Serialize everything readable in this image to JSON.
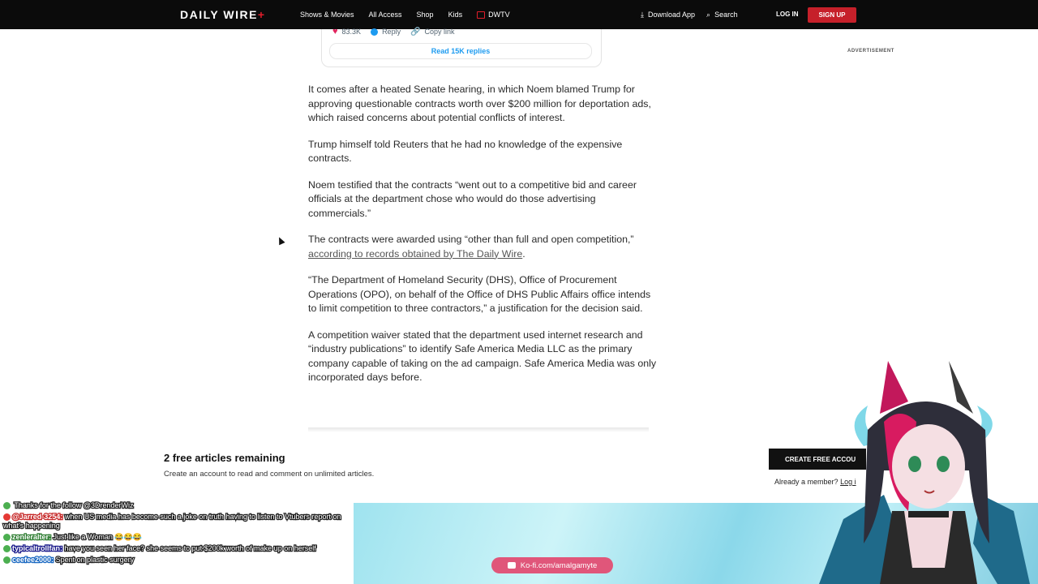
{
  "header": {
    "logo": "DAILY WIRE",
    "logo_plus": "+",
    "nav": [
      "Shows & Movies",
      "All Access",
      "Shop",
      "Kids",
      "DWTV"
    ],
    "download": "Download App",
    "search": "Search",
    "login": "LOG IN",
    "signup": "SIGN UP"
  },
  "tweet": {
    "likes": "83.3K",
    "reply": "Reply",
    "copy": "Copy link",
    "read_replies": "Read 15K replies"
  },
  "advertisement": "ADVERTISEMENT",
  "article": {
    "p1": "It comes after a heated Senate hearing, in which Noem blamed Trump for approving questionable contracts worth over $200 million for deportation ads, which raised concerns about potential conflicts of interest.",
    "p2": "Trump himself told Reuters that he had no knowledge of the expensive contracts.",
    "p3": "Noem testified that the contracts “went out to a competitive bid and career officials at the department chose who would do those advertising commercials.”",
    "p4a": "The contracts were awarded using “other than full and open competition,”",
    "p4link": "according to records obtained by The Daily Wire",
    "p4b": ".",
    "p5": "“The Department of Homeland Security (DHS), Office of Procurement Operations (OPO), on behalf of the Office of DHS Public Affairs office intends to limit competition to three contractors,” a justification for the decision said.",
    "p6": "A competition waiver stated that the department used internet research and “industry publications” to identify Safe America Media LLC as the primary company capable of taking on the ad campaign. Safe America Media was only incorporated days before."
  },
  "paywall": {
    "title": "2 free articles remaining",
    "subtitle": "Create an account to read and comment on unlimited articles.",
    "create": "CREATE FREE ACCOU",
    "member": "Already a member?",
    "login": "Log i"
  },
  "chat": [
    {
      "user": "",
      "msg": "Thanks for the follow @3DrenderWiz",
      "color": "#e11d2a"
    },
    {
      "user": "@Jarred-3254:",
      "msg": "when US media has become such a joke on truth having to listen to Vtubers report on what's happening",
      "color": "#c62828"
    },
    {
      "user": "zenleralter:",
      "msg": "Just like a Woman 😂😂😂",
      "color": "#2e7d32"
    },
    {
      "user": "typicaltrollfan:",
      "msg": "have you seen her face? she seems to put $200k worth of make up on herself",
      "color": "#1a1a8a"
    },
    {
      "user": "ceefee2000:",
      "msg": "Spent on plastic surgery",
      "color": "#1565c0"
    }
  ],
  "kofi": "Ko-fi.com/amalgamyte",
  "colors": {
    "brand_red": "#c6202a",
    "twitter_blue": "#1d9bf0",
    "kofi_pink": "#e0567a"
  }
}
